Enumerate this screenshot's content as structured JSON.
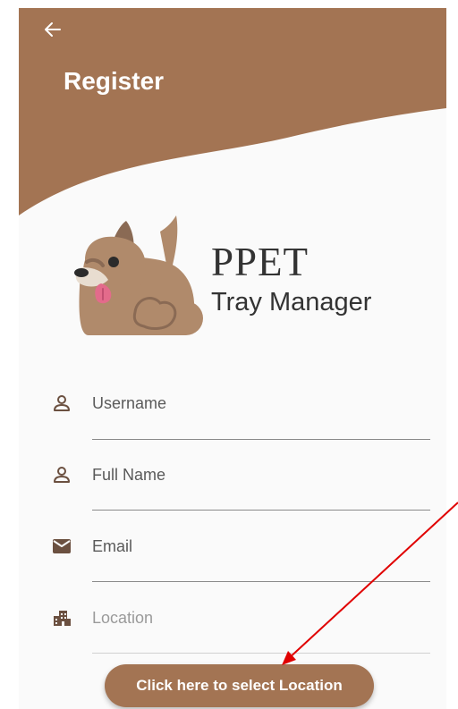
{
  "colors": {
    "brand": "#a37453",
    "background": "#fafafa",
    "annotation": "#e00000"
  },
  "header": {
    "back_icon": "arrow-left-icon",
    "title": "Register"
  },
  "brand": {
    "logo": "dog-icon",
    "title": "PPET",
    "subtitle": "Tray Manager"
  },
  "form": {
    "fields": [
      {
        "icon": "person-icon",
        "placeholder": "Username",
        "value": ""
      },
      {
        "icon": "person-icon",
        "placeholder": "Full Name",
        "value": ""
      },
      {
        "icon": "mail-icon",
        "placeholder": "Email",
        "value": ""
      },
      {
        "icon": "building-icon",
        "placeholder": "Location",
        "value": "",
        "enabled": false
      }
    ]
  },
  "location_button": {
    "label": "Click here to select Location"
  }
}
